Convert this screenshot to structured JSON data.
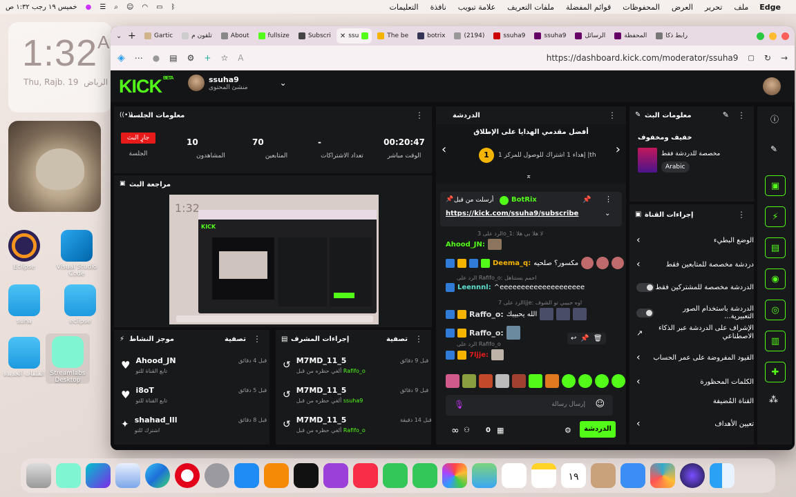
{
  "menubar": {
    "app_name": "Edge",
    "items": [
      "ملف",
      "تحرير",
      "العرض",
      "المحفوظات",
      "قوائم المفضلة",
      "ملفات التعريف",
      "علامة تبويب",
      "نافذة",
      "التعليمات"
    ],
    "datetime": "خميس ١٩ رجب ١:٣٢ ص"
  },
  "clock_widget": {
    "time": "1:32",
    "suffix": "A",
    "date": "Thu, Rajb. 19",
    "city": "الرياض"
  },
  "desktop_icons": [
    "Eclipse",
    "Visual Studio Code",
    "suha",
    "eclipse",
    "الملفات الجديدة",
    "Streamlabs Desktop"
  ],
  "browser": {
    "tabs": [
      "Gartic",
      "تلقون م",
      "About",
      "fullsize",
      "Subscri",
      "ssu",
      "The be",
      "botrix",
      "(2194)",
      "ssuha9",
      "ssuha9",
      "الرسائل",
      "المحفظة",
      "رابط ذكا"
    ],
    "url": "https://dashboard.kick.com/moderator/ssuha9"
  },
  "header": {
    "logo": "KICK",
    "logo_badge": "BETA",
    "channel_name": "ssuha9",
    "channel_role": "منشئ المحتوى"
  },
  "session_info": {
    "title": "معلومات الجلسة",
    "live_badge": "جارٍ البث",
    "session_label": "الجلسة",
    "stats": [
      {
        "label": "الوقت مباشر",
        "value": "00:20:47"
      },
      {
        "label": "تعداد الاشتراكات",
        "value": "-"
      },
      {
        "label": "المتابعين",
        "value": "70"
      },
      {
        "label": "المشاهدون",
        "value": "10"
      }
    ]
  },
  "stream_preview": {
    "title": "مراجعة البث",
    "preview_time": "1:32"
  },
  "activity_feed": {
    "title": "موجز النشاط",
    "filter": "تصفية",
    "items": [
      {
        "name": "Ahood_JN",
        "action": "تابع القناة للتو",
        "time": "قبل 4 دقائق"
      },
      {
        "name": "i8oT",
        "action": "تابع القناة للتو",
        "time": "قبل 5 دقائق"
      },
      {
        "name": "shahad_lll",
        "action": "اشترك للتو",
        "time": "قبل 8 دقائق"
      }
    ]
  },
  "mod_actions": {
    "title": "إجراءات المشرف",
    "filter": "تصفية",
    "items": [
      {
        "name": "M7MD_11_5",
        "action": "ألغي حظره من قبل",
        "by": "Rafifo_o",
        "time": "قبل 9 دقائق"
      },
      {
        "name": "M7MD_11_5",
        "action": "ألغي حظره من قبل",
        "by": "ssuha9",
        "time": "قبل 9 دقائق"
      },
      {
        "name": "M7MD_11_5",
        "action": "ألغي حظره من قبل",
        "by": "Rafifo_o",
        "time": "قبل 14 دقيقة"
      }
    ]
  },
  "chat": {
    "title": "الدردشة",
    "leaderboard_title": "أفضل مقدمي الهدايا على الإطلاق",
    "leaderboard_sub": "إهداء 1 اشتراك للوصول للمركز 1 |th",
    "leaderboard_rank": "1",
    "pinned_by_label": "أرسلت من قبل",
    "pinned_user": "BotRix",
    "pinned_link": "https://kick.com/ssuha9/subscribe",
    "messages": [
      {
        "reply": "الرد على 3o_1: لا هلا بي هلا",
        "user": "Ahood_JN:",
        "text": ""
      },
      {
        "reply": "",
        "user": "Deema_q:",
        "text": "مكسور؟ صلحيه"
      },
      {
        "reply": "الرد على Rafifo_o: احمم يستناهل",
        "user": "Leennnl:",
        "text": "^eeeeeeeeeeeeeeeeeeee"
      },
      {
        "reply": "الرد على 7ljje: اوه حبيبي تو الشوف",
        "user": "Raffo_o:",
        "text": "الله يحبيبك"
      },
      {
        "reply": "",
        "user": "Raffo_o:",
        "text": ""
      },
      {
        "reply": "الرد على Rafifo_o",
        "user": "7ljje:",
        "text": ""
      }
    ],
    "input_placeholder": "إرسال رسالة",
    "send_button": "الدردشة",
    "counter": "0"
  },
  "stream_info": {
    "title": "معلومات البث",
    "stream_title": "خفيف ومخفوف",
    "category": "مخصصة للدردشة فقط",
    "language": "Arabic"
  },
  "channel_actions": {
    "title": "إجراءات القناة",
    "items": [
      {
        "label": "الوضع البطيء",
        "control": "chevron"
      },
      {
        "label": "دردشة مخصصة للمتابعين فقط",
        "control": "chevron"
      },
      {
        "label": "الدردشة مخصصة للمشتركين فقط",
        "control": "toggle"
      },
      {
        "label": "الدردشة باستخدام الصور التعبيرية...",
        "control": "toggle"
      },
      {
        "label": "الإشراف على الدردشة عبر الذكاء الاصطناعي",
        "control": "link"
      },
      {
        "label": "القيود المفروضة على عمر الحساب",
        "control": "chevron"
      },
      {
        "label": "الكلمات المحظورة",
        "control": "chevron"
      },
      {
        "label": "القناة المُضيفة",
        "control": "none"
      },
      {
        "label": "تعيين الأهداف",
        "control": "chevron"
      }
    ]
  },
  "dock_apps": [
    "Trash",
    "Streamlabs",
    "Canva",
    "Preview",
    "Edge",
    "Opera",
    "Settings",
    "App Store",
    "Books",
    "TV",
    "Podcasts",
    "Music",
    "FaceTime",
    "Messages",
    "Photos",
    "Maps",
    "Reminders",
    "Notes",
    "Calendar",
    "Contacts",
    "Mail",
    "Grid",
    "Siri",
    "Finder"
  ],
  "calendar_day": "١٩",
  "colors": {
    "kick_green": "#53fc18",
    "live_red": "#e91a1a",
    "panel": "#18191b",
    "bg": "#0e0e10"
  }
}
